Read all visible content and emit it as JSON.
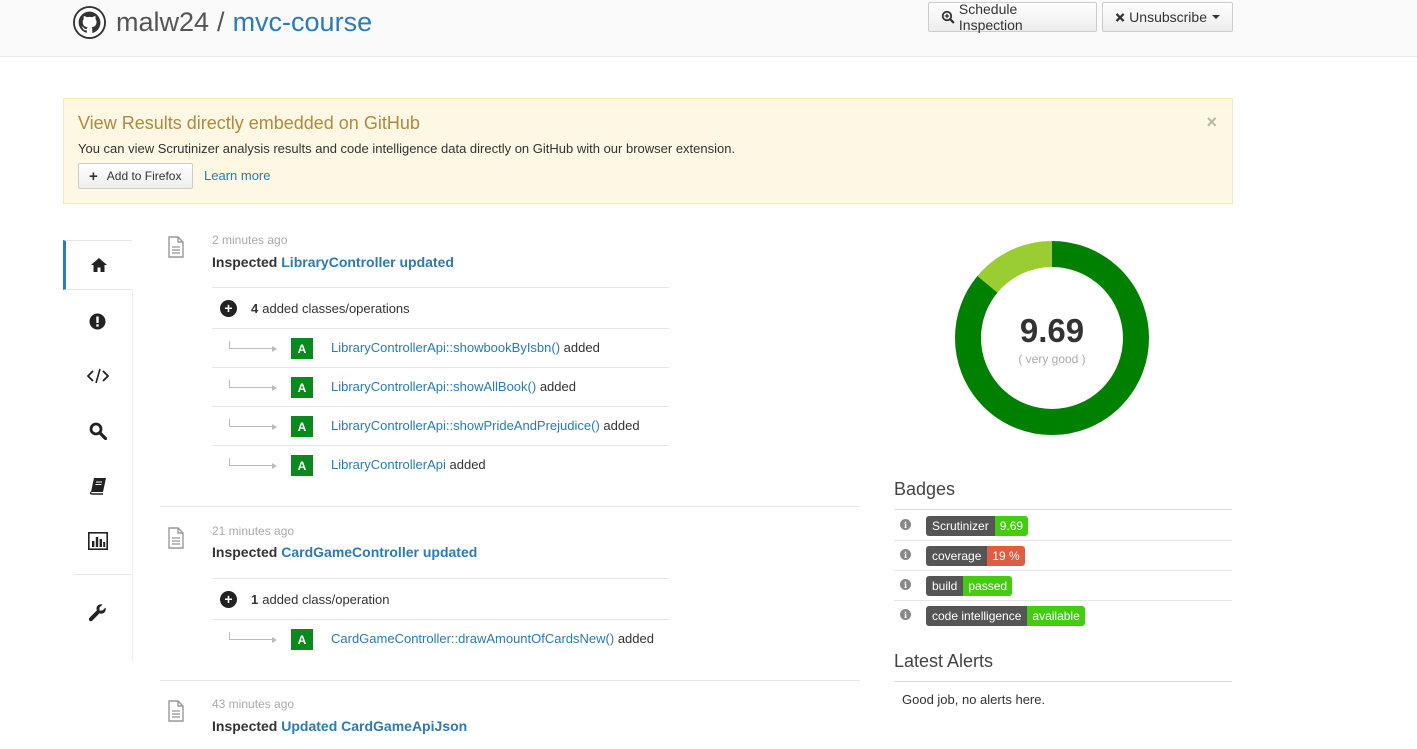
{
  "header": {
    "owner": "malw24",
    "separator": "/",
    "repo": "mvc-course",
    "schedule_label": "Schedule Inspection",
    "unsubscribe_label": "Unsubscribe"
  },
  "alert": {
    "title": "View Results directly embedded on GitHub",
    "text": "You can view Scrutinizer analysis results and code intelligence data directly on GitHub with our browser extension.",
    "close": "×",
    "firefox_label": "Add to Firefox",
    "learn_more": "Learn more"
  },
  "sidebar": {
    "items": [
      "home",
      "issues",
      "code",
      "search",
      "documentation",
      "statistics",
      "settings"
    ]
  },
  "feed": [
    {
      "time": "2 minutes ago",
      "prefix": "Inspected",
      "title": "LibraryController updated",
      "summary_count": "4",
      "summary_text": "added classes/operations",
      "changes": [
        {
          "name": "LibraryControllerApi::showbookByIsbn()",
          "status": "added",
          "badge": "A"
        },
        {
          "name": "LibraryControllerApi::showAllBook()",
          "status": "added",
          "badge": "A"
        },
        {
          "name": "LibraryControllerApi::showPrideAndPrejudice()",
          "status": "added",
          "badge": "A"
        },
        {
          "name": "LibraryControllerApi",
          "status": "added",
          "badge": "A"
        }
      ]
    },
    {
      "time": "21 minutes ago",
      "prefix": "Inspected",
      "title": "CardGameController updated",
      "summary_count": "1",
      "summary_text": "added class/operation",
      "changes": [
        {
          "name": "CardGameController::drawAmountOfCardsNew()",
          "status": "added",
          "badge": "A"
        }
      ]
    },
    {
      "time": "43 minutes ago",
      "prefix": "Inspected",
      "title": "Updated CardGameApiJson"
    }
  ],
  "score": {
    "value": "9.69",
    "label": "( very good )",
    "fraction_excellent": 0.86,
    "fraction_good": 0.14,
    "color_excellent": "#008000",
    "color_good": "#9acd32"
  },
  "badges": {
    "title": "Badges",
    "items": [
      {
        "key": "Scrutinizer",
        "value": "9.69",
        "color": "#4c1"
      },
      {
        "key": "coverage",
        "value": "19 %",
        "color": "#e05d44"
      },
      {
        "key": "build",
        "value": "passed",
        "color": "#4c1"
      },
      {
        "key": "code intelligence",
        "value": "available",
        "color": "#4c1"
      }
    ]
  },
  "alerts_section": {
    "title": "Latest Alerts",
    "empty_text": "Good job, no alerts here."
  }
}
